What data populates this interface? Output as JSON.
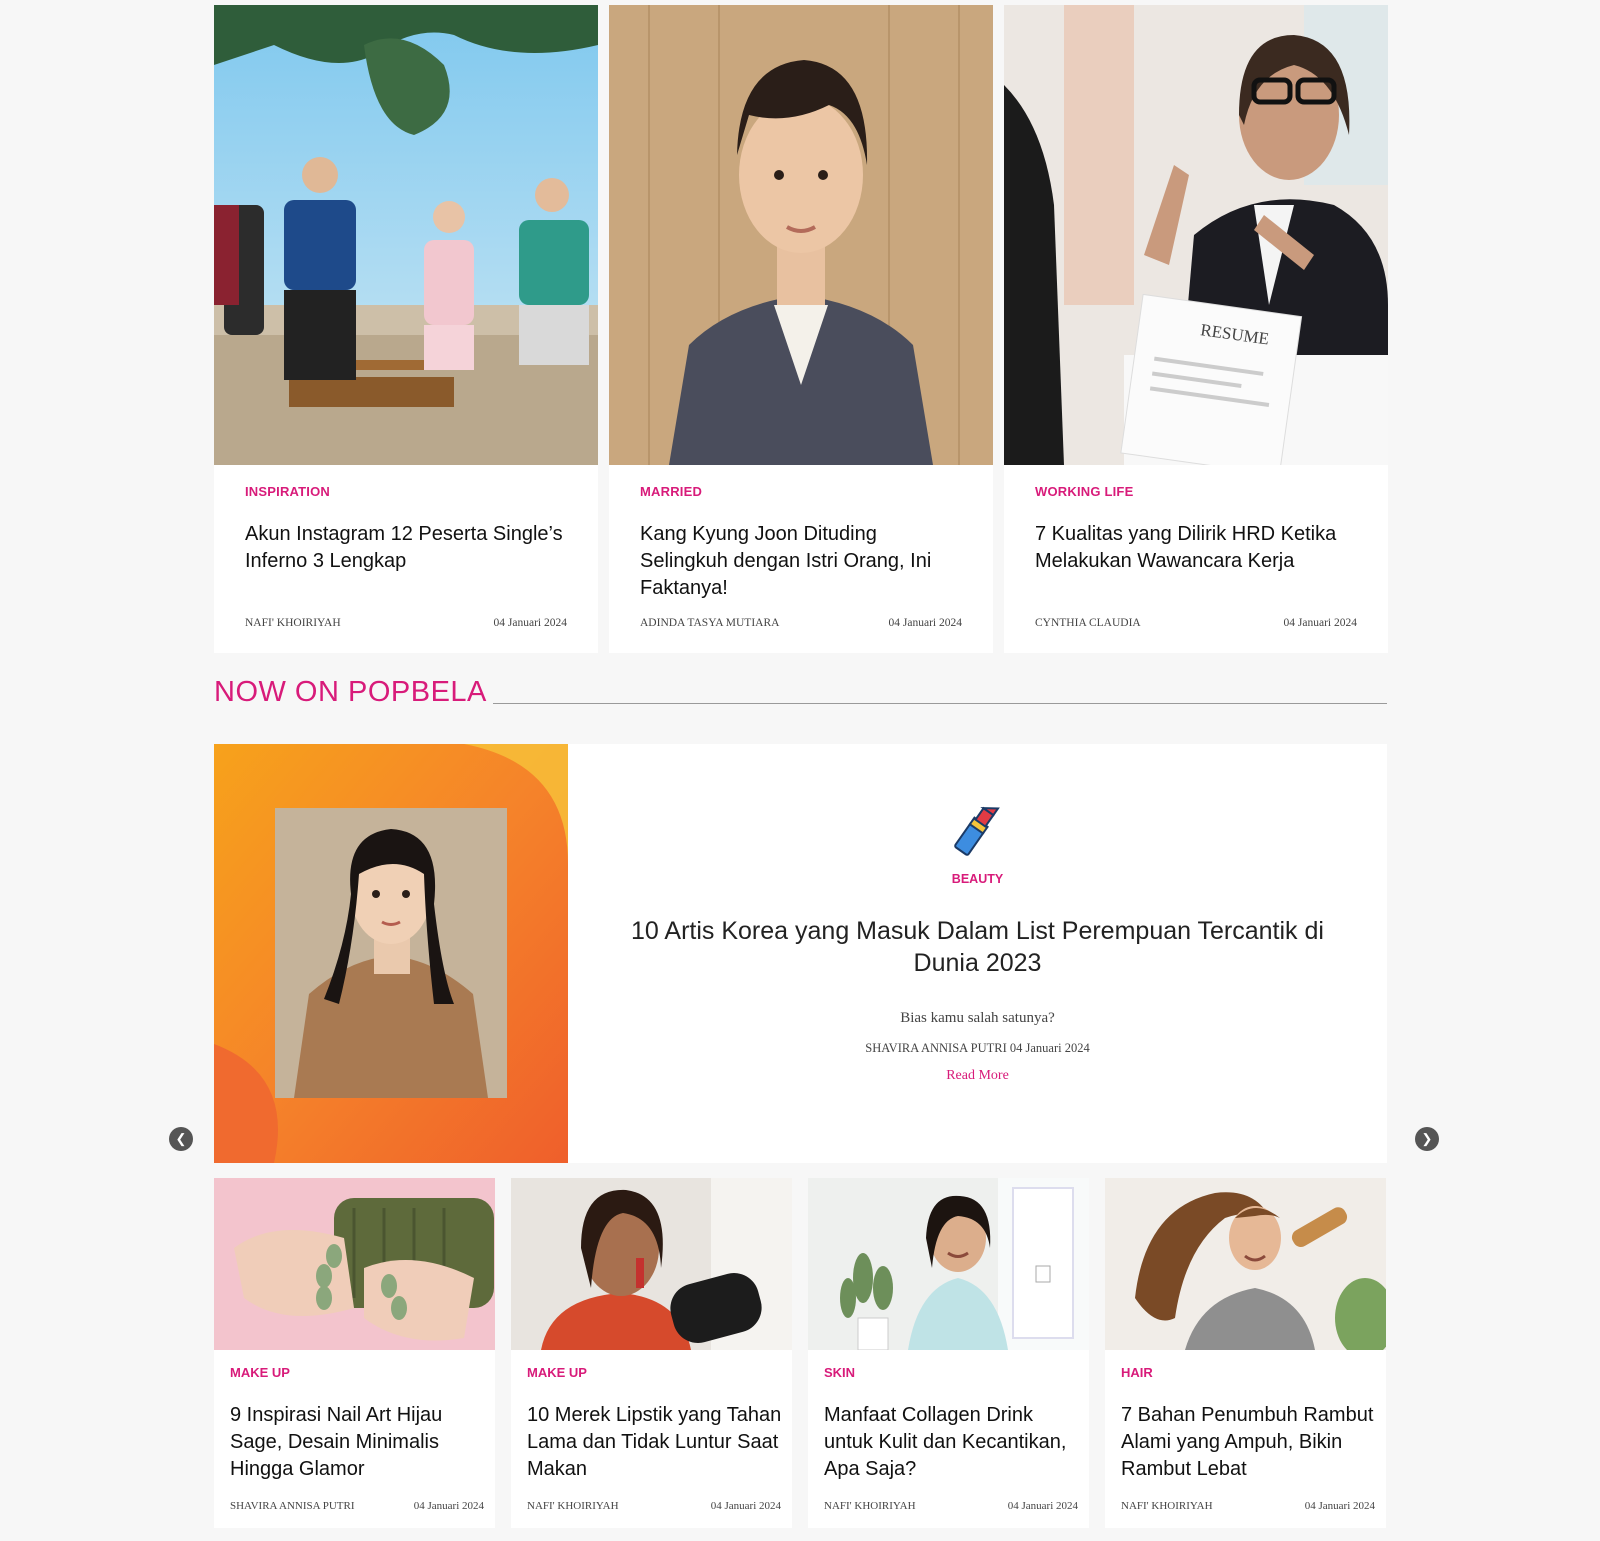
{
  "top_articles": [
    {
      "category": "INSPIRATION",
      "title": "Akun Instagram 12 Peserta Single’s Inferno 3 Lengkap",
      "author": "NAFI' KHOIRIYAH",
      "date": "04 Januari 2024"
    },
    {
      "category": "MARRIED",
      "title": "Kang Kyung Joon Dituding Selingkuh dengan Istri Orang, Ini Faktanya!",
      "author": "ADINDA TASYA MUTIARA",
      "date": "04 Januari 2024"
    },
    {
      "category": "WORKING LIFE",
      "title": "7 Kualitas yang Dilirik HRD Ketika Melakukan Wawancara Kerja",
      "author": "CYNTHIA CLAUDIA",
      "date": "04 Januari 2024"
    }
  ],
  "resume_text": "RESUME",
  "section": {
    "title": "NOW ON POPBELA"
  },
  "featured": {
    "category": "BEAUTY",
    "icon": "lipstick-icon",
    "title": "10 Artis Korea yang Masuk Dalam List Perempuan Tercantik di Dunia 2023",
    "subtitle": "Bias kamu salah satunya?",
    "author": "SHAVIRA ANNISA PUTRI",
    "date": "04 Januari 2024",
    "read_more": "Read More"
  },
  "carousel": {
    "prev_icon": "chevron-left-icon",
    "next_icon": "chevron-right-icon",
    "prev_glyph": "❮",
    "next_glyph": "❯"
  },
  "bottom_articles": [
    {
      "category": "MAKE UP",
      "title": "9 Inspirasi Nail Art Hijau Sage, Desain Minimalis Hingga Glamor",
      "author": "SHAVIRA ANNISA PUTRI",
      "date": "04 Januari 2024"
    },
    {
      "category": "MAKE UP",
      "title": "10 Merek Lipstik yang Tahan Lama dan Tidak Luntur Saat Makan",
      "author": "NAFI' KHOIRIYAH",
      "date": "04 Januari 2024"
    },
    {
      "category": "SKIN",
      "title": "Manfaat Collagen Drink untuk Kulit dan Kecantikan, Apa Saja?",
      "author": "NAFI' KHOIRIYAH",
      "date": "04 Januari 2024"
    },
    {
      "category": "HAIR",
      "title": "7 Bahan Penumbuh Rambut Alami yang Ampuh, Bikin Rambut Lebat",
      "author": "NAFI' KHOIRIYAH",
      "date": "04 Januari 2024"
    }
  ],
  "colors": {
    "accent": "#d81b7a",
    "background": "#f7f7f7",
    "card": "#ffffff"
  }
}
